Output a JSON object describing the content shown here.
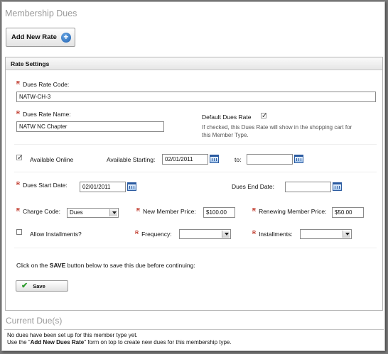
{
  "page": {
    "title": "Membership Dues"
  },
  "toolbar": {
    "add_label": "Add New Rate",
    "add_icon": "plus-circle-icon"
  },
  "rate_settings": {
    "header": "Rate Settings",
    "required_mark": "R",
    "code_label": "Dues Rate Code:",
    "code_value": "NATW-CH-3",
    "name_label": "Dues Rate Name:",
    "name_value": "NATW NC Chapter",
    "default_label": "Default Dues Rate",
    "default_checked": true,
    "default_help_1": "If checked, this Dues Rate will show in the shopping cart for",
    "default_help_2": "this Member Type.",
    "online_label": "Available Online",
    "online_checked": true,
    "starting_label": "Available Starting:",
    "starting_value": "02/01/2011",
    "to_label": "to:",
    "to_value": "",
    "start_label": "Dues Start Date:",
    "start_value": "02/01/2011",
    "end_label": "Dues End Date:",
    "end_value": "",
    "charge_label": "Charge Code:",
    "charge_value": "Dues",
    "new_price_label": "New Member Price:",
    "new_price_value": "$100.00",
    "renew_price_label": "Renewing Member Price:",
    "renew_price_value": "$50.00",
    "installments_allow_label": "Allow Installments?",
    "installments_allow_checked": false,
    "frequency_label": "Frequency:",
    "frequency_value": "",
    "installments_label": "Installments:",
    "installments_value": "",
    "note_pre": "Click on the ",
    "note_bold": "SAVE",
    "note_post": " button below to save this due before continuing:",
    "save_label": "Save"
  },
  "current": {
    "title": "Current Due(s)",
    "line1": "No dues have been set up for this member type yet.",
    "line2_pre": "Use the \"",
    "line2_bold": "Add New Dues Rate",
    "line2_post": "\" form on top to create new dues for this membership type."
  }
}
